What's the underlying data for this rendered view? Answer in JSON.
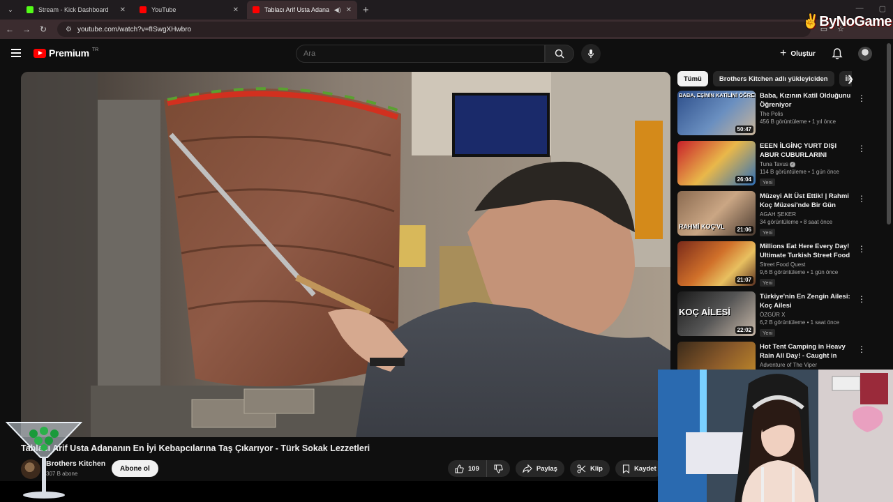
{
  "browser": {
    "tabs": [
      {
        "title": "Stream - Kick Dashboard",
        "favicon_color": "#53fc18"
      },
      {
        "title": "YouTube",
        "favicon_color": "#ff0000"
      },
      {
        "title": "Tablacı Arif Usta Adananın E",
        "favicon_color": "#ff0000",
        "active": true
      }
    ],
    "url": "youtube.com/watch?v=fISwgXHwbro",
    "watermark": "ByNoGame"
  },
  "header": {
    "logo_text": "Premium",
    "logo_country": "TR",
    "search_placeholder": "Ara",
    "create_label": "Oluştur"
  },
  "video": {
    "title": "Tablacı Arif Usta Adananın En İyi Kebapcılarına Taş Çıkarıyor - Türk Sokak Lezzetleri",
    "channel": "Brothers Kitchen",
    "subscribers": "307 B abone",
    "subscribe_label": "Abone ol",
    "likes": "109",
    "share_label": "Paylaş",
    "clip_label": "Klip",
    "save_label": "Kaydet"
  },
  "chips": [
    "Tümü",
    "Brothers Kitchen adlı yükleyiciden",
    "İlgili"
  ],
  "recommendations": [
    {
      "title": "Baba, Kızının Katil Olduğunu Öğreniyor",
      "channel": "The Polis",
      "stats": "456 B görüntüleme • 1 yıl önce",
      "duration": "50:47",
      "thumb_text": "BABA, EŞİNİN KATİLİNİ ÖĞRENİYOR",
      "badge": ""
    },
    {
      "title": "EEEN İLGİNÇ YURT DIŞI ABUR CUBURLARINI DENEDİK! KR",
      "channel": "Tuna Tavus",
      "stats": "114 B görüntüleme • 1 gün önce",
      "duration": "26:04",
      "thumb_text": "",
      "badge": "Yeni"
    },
    {
      "title": "Müzeyi Alt Üst Ettik! | Rahmi Koç Müzesi'nde Bir Gün",
      "channel": "AGAH ŞEKER",
      "stats": "34 görüntüleme • 8 saat önce",
      "duration": "21:06",
      "thumb_text": "RAHMİ KOÇ'VL",
      "badge": "Yeni"
    },
    {
      "title": "Millions Eat Here Every Day! Ultimate Turkish Street Food ...",
      "channel": "Street Food Quest",
      "stats": "9,6 B görüntüleme • 1 gün önce",
      "duration": "21:07",
      "thumb_text": "",
      "badge": "Yeni"
    },
    {
      "title": "Türkiye'nin En Zengin Ailesi: Koç Ailesi",
      "channel": "ÖZGÜR X",
      "stats": "6,2 B görüntüleme • 1 saat önce",
      "duration": "22:02",
      "thumb_text": "KOÇ AİLESİ",
      "badge": "Yeni"
    },
    {
      "title": "Hot Tent Camping in Heavy Rain All Day! - Caught in Rainstorm ...",
      "channel": "Adventure of The Viper",
      "stats": "",
      "duration": "",
      "thumb_text": "",
      "badge": ""
    }
  ],
  "icons": {
    "tab_menu": "chevron-down-icon",
    "back": "arrow-left-icon",
    "forward": "arrow-right-icon",
    "reload": "reload-icon",
    "search": "search-icon",
    "mic": "mic-icon",
    "bell": "bell-icon",
    "like": "thumb-up-icon",
    "dislike": "thumb-down-icon",
    "share": "share-icon",
    "clip": "scissors-icon",
    "save": "bookmark-icon"
  },
  "colors": {
    "background": "#0f0f0f",
    "brand": "#ff0000",
    "tab_active": "#3b2c2f"
  }
}
